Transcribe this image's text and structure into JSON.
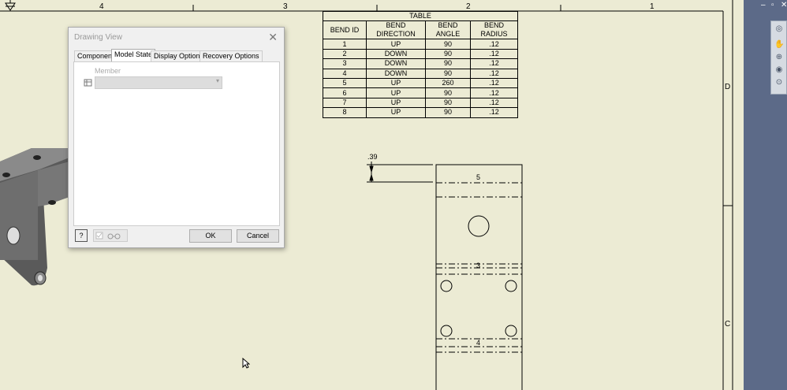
{
  "ruler": {
    "numbers": [
      "4",
      "3",
      "2",
      "1"
    ]
  },
  "zones": {
    "right": [
      "D",
      "C"
    ]
  },
  "bend_table": {
    "title": "TABLE",
    "headers": [
      "BEND ID",
      "BEND DIRECTION",
      "BEND ANGLE",
      "BEND RADIUS"
    ],
    "rows": [
      [
        "1",
        "UP",
        "90",
        ".12"
      ],
      [
        "2",
        "DOWN",
        "90",
        ".12"
      ],
      [
        "3",
        "DOWN",
        "90",
        ".12"
      ],
      [
        "4",
        "DOWN",
        "90",
        ".12"
      ],
      [
        "5",
        "UP",
        "260",
        ".12"
      ],
      [
        "6",
        "UP",
        "90",
        ".12"
      ],
      [
        "7",
        "UP",
        "90",
        ".12"
      ],
      [
        "8",
        "UP",
        "90",
        ".12"
      ]
    ]
  },
  "flat_pattern": {
    "dimension": ".39",
    "bend_labels": [
      "5",
      "3",
      "4"
    ]
  },
  "dialog": {
    "title": "Drawing View",
    "close_glyph": "✕",
    "tabs": [
      "Component",
      "Model State",
      "Display Options",
      "Recovery Options"
    ],
    "active_tab": "Model State",
    "member_label": "Member",
    "member_value": "",
    "help_glyph": "?",
    "ok_label": "OK",
    "cancel_label": "Cancel"
  },
  "window_controls": {
    "minimize": "–",
    "restore": "▫",
    "close": "✕"
  },
  "colors": {
    "sheet": "#ecebd4",
    "side_panel": "#5c6a88"
  }
}
